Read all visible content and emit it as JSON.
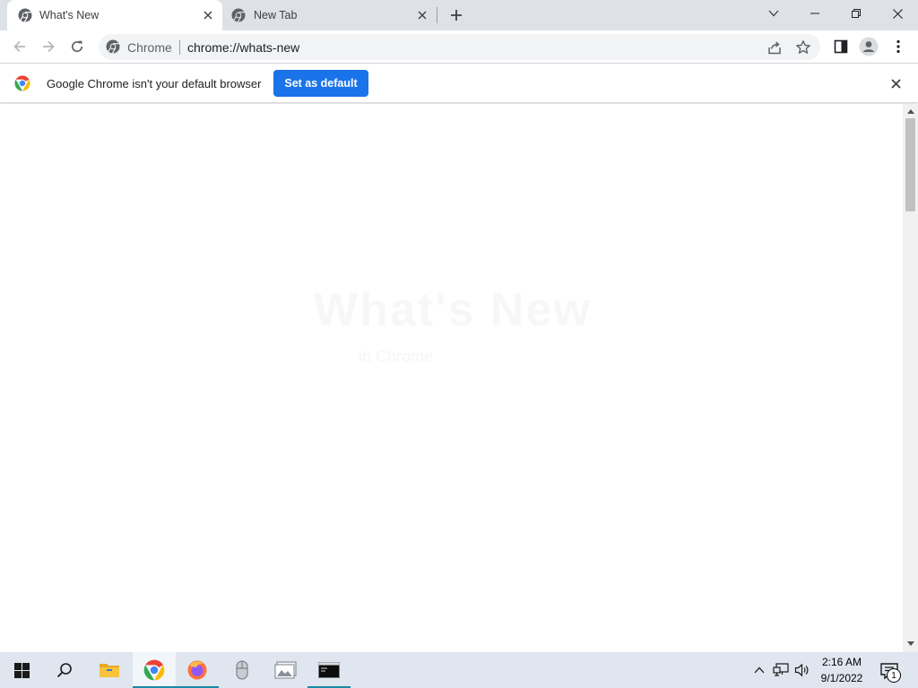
{
  "tabs": [
    {
      "title": "What's New",
      "active": true,
      "icon": "chrome-favicon-icon"
    },
    {
      "title": "New Tab",
      "active": false,
      "icon": "chrome-favicon-icon"
    }
  ],
  "omnibox": {
    "chip": "Chrome",
    "url": "chrome://whats-new"
  },
  "infobar": {
    "message": "Google Chrome isn't your default browser",
    "button": "Set as default"
  },
  "content": {
    "ghost_title": "What's New",
    "ghost_subtitle": "in Chrome"
  },
  "taskbar": {
    "apps": [
      "windows-start-icon",
      "search-icon",
      "file-explorer-icon",
      "chrome-icon",
      "firefox-icon",
      "mouse-app-icon",
      "photos-app-icon",
      "terminal-icon"
    ],
    "clock_time": "2:16 AM",
    "clock_date": "9/1/2022",
    "notification_count": "1"
  },
  "colors": {
    "tabstrip": "#dee1e6",
    "accent": "#1a73e8",
    "taskbar": "#dfe6ef"
  }
}
